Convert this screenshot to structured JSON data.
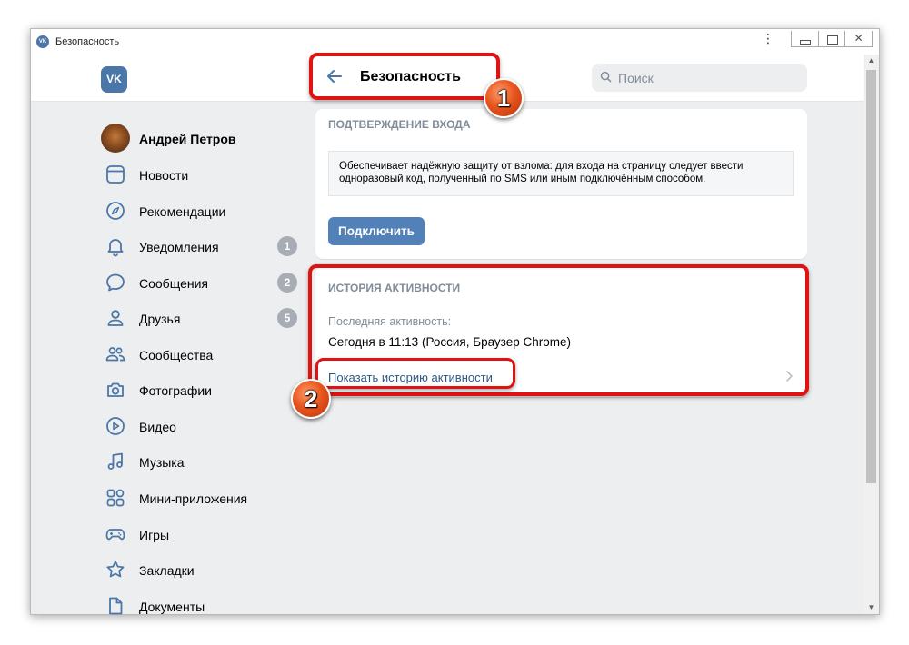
{
  "window": {
    "title": "Безопасность",
    "app_icon": "vk-icon",
    "minimize_label": "",
    "maximize_label": "",
    "close_label": "✕"
  },
  "header": {
    "logo_text": "VK",
    "page_title": "Безопасность",
    "search_placeholder": "Поиск"
  },
  "sidebar": {
    "user_name": "Андрей Петров",
    "items": [
      {
        "label": "Новости",
        "icon": "newspaper-icon",
        "badge": ""
      },
      {
        "label": "Рекомендации",
        "icon": "compass-icon",
        "badge": ""
      },
      {
        "label": "Уведомления",
        "icon": "bell-icon",
        "badge": "1"
      },
      {
        "label": "Сообщения",
        "icon": "message-bubble-icon",
        "badge": "2"
      },
      {
        "label": "Друзья",
        "icon": "user-icon",
        "badge": "5"
      },
      {
        "label": "Сообщества",
        "icon": "group-icon",
        "badge": ""
      },
      {
        "label": "Фотографии",
        "icon": "camera-icon",
        "badge": ""
      },
      {
        "label": "Видео",
        "icon": "play-circle-icon",
        "badge": ""
      },
      {
        "label": "Музыка",
        "icon": "music-note-icon",
        "badge": ""
      },
      {
        "label": "Мини-приложения",
        "icon": "grid-apps-icon",
        "badge": ""
      },
      {
        "label": "Игры",
        "icon": "gamepad-icon",
        "badge": ""
      },
      {
        "label": "Закладки",
        "icon": "star-icon",
        "badge": ""
      },
      {
        "label": "Документы",
        "icon": "document-icon",
        "badge": ""
      }
    ]
  },
  "login_confirmation": {
    "title": "ПОДТВЕРЖДЕНИЕ ВХОДА",
    "description_line1": "Обеспечивает надёжную защиту от взлома: для входа на страницу следует ввести",
    "description_line2": "одноразовый код, полученный по SMS или иным подключённым способом.",
    "button_label": "Подключить"
  },
  "activity_history": {
    "title": "ИСТОРИЯ АКТИВНОСТИ",
    "last_activity_label": "Последняя активность:",
    "last_activity_value": "Сегодня в 11:13 (Россия, Браузер Chrome)",
    "show_history_link": "Показать историю активности"
  },
  "annotations": {
    "marker1": "1",
    "marker2": "2",
    "highlight_color": "#e01212"
  },
  "colors": {
    "accent": "#4a76a8",
    "button": "#5181b8",
    "link": "#2a5885",
    "muted": "#818c99",
    "background": "#edeef0"
  }
}
